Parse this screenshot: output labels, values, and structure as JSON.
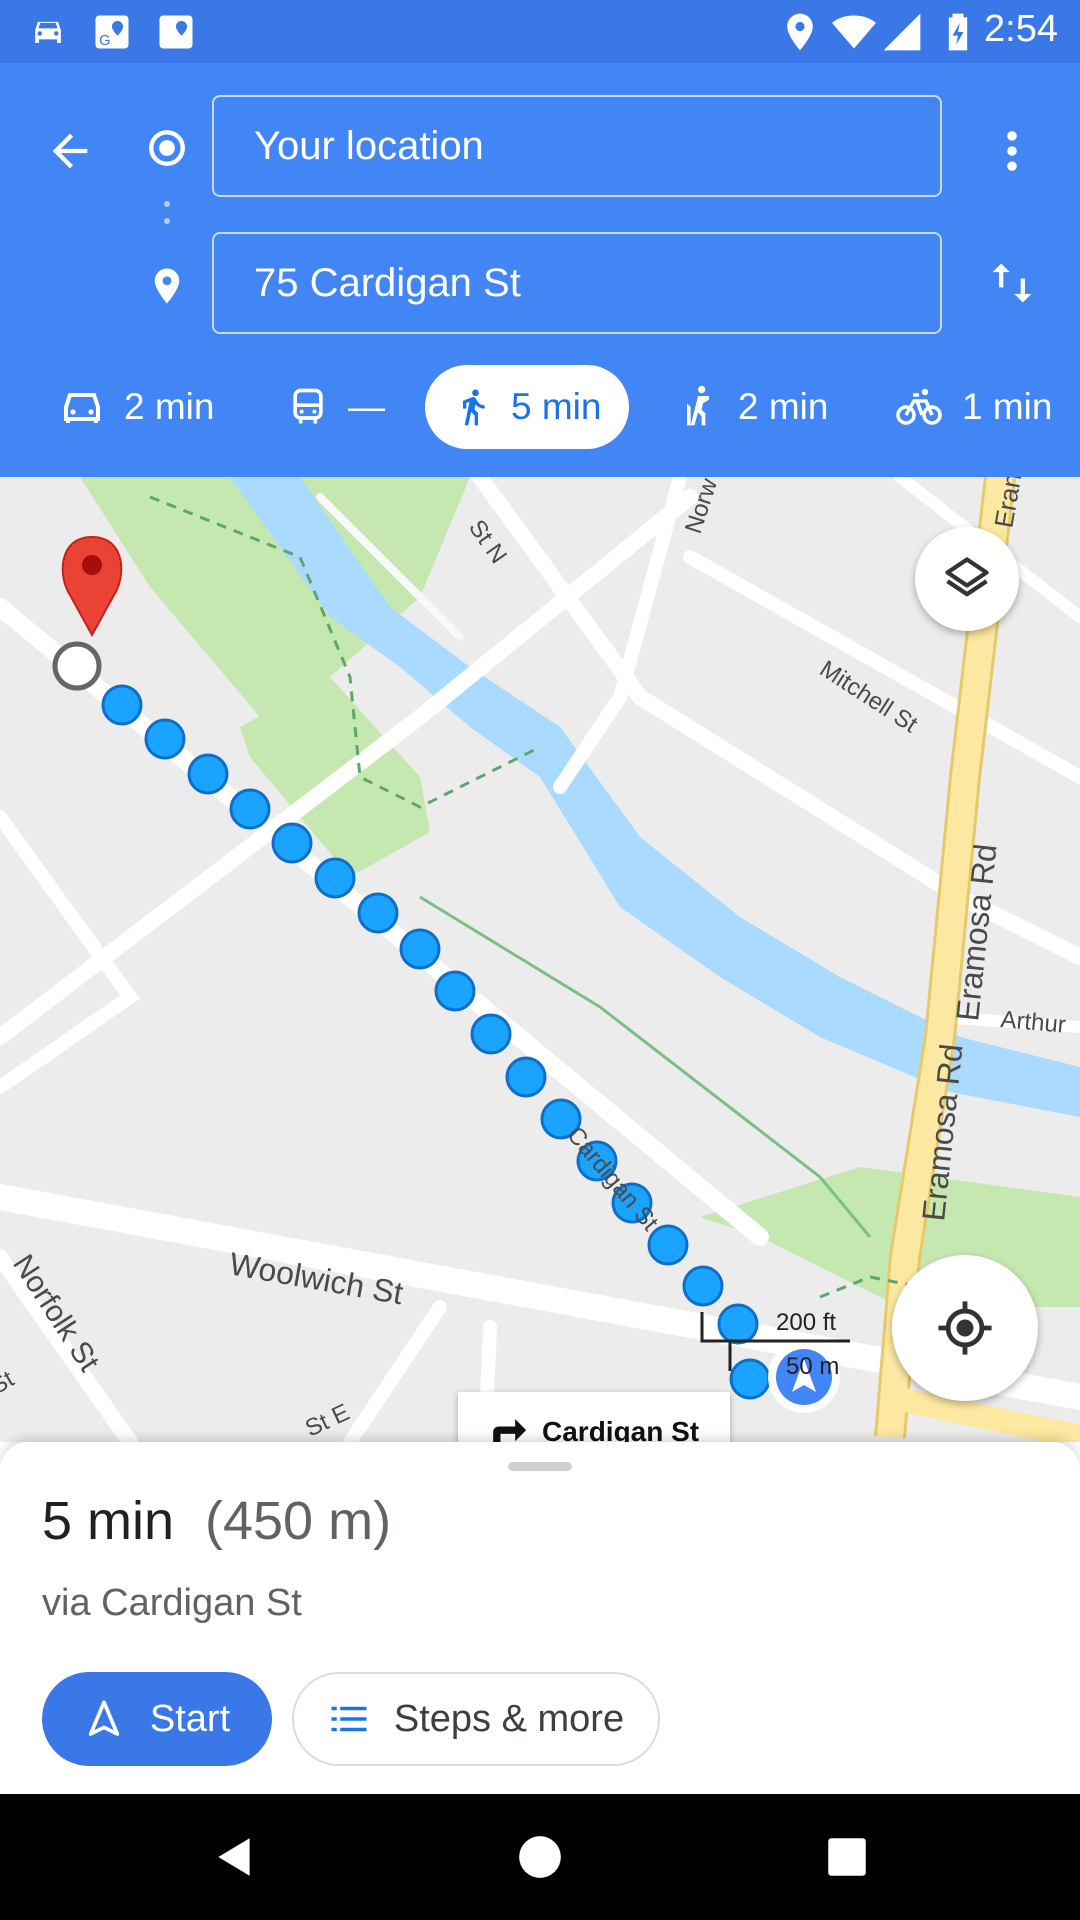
{
  "status_bar": {
    "time": "2:54",
    "icons": [
      "car-icon",
      "maps-icon",
      "maps-icon",
      "location-icon",
      "wifi-icon",
      "signal-icon",
      "battery-charging-icon"
    ]
  },
  "directions": {
    "origin": "Your location",
    "destination": "75 Cardigan St",
    "modes": [
      {
        "name": "drive",
        "icon": "car-icon",
        "label": "2 min"
      },
      {
        "name": "transit",
        "icon": "bus-icon",
        "label": "—"
      },
      {
        "name": "walk",
        "icon": "walk-icon",
        "label": "5 min",
        "selected": true
      },
      {
        "name": "rideshare",
        "icon": "ride-icon",
        "label": "2 min"
      },
      {
        "name": "bike",
        "icon": "bike-icon",
        "label": "1 min"
      }
    ]
  },
  "map": {
    "streets": [
      "Mitchell St",
      "Eramosa Rd",
      "Eramosa Rd",
      "Arthur",
      "Woolwich St",
      "Norfolk St",
      "Cardigan St",
      "St E",
      "St",
      "St N",
      "Norw",
      "Eran"
    ],
    "scale": {
      "imperial": "200 ft",
      "metric": "50 m"
    },
    "turn_hint": "Cardigan St",
    "colors": {
      "route": "#1aa3ff",
      "water": "#aadaff",
      "park": "#c5e8b0",
      "major_road": "#fce8a0",
      "pin": "#ea4335"
    }
  },
  "summary": {
    "duration": "5 min",
    "distance": "(450 m)",
    "via": "via Cardigan St",
    "start_label": "Start",
    "steps_label": "Steps & more"
  }
}
